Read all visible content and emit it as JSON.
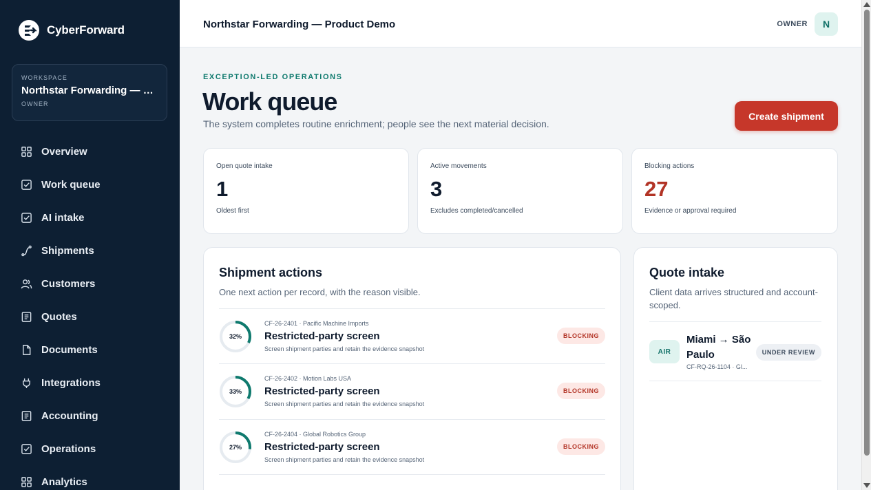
{
  "brand": {
    "name": "CyberForward"
  },
  "workspace": {
    "label": "WORKSPACE",
    "name": "Northstar Forwarding — Product Demo",
    "role": "OWNER"
  },
  "nav": [
    {
      "label": "Overview",
      "icon": "grid-icon"
    },
    {
      "label": "Work queue",
      "icon": "checkbox-icon"
    },
    {
      "label": "AI intake",
      "icon": "checkbox-icon"
    },
    {
      "label": "Shipments",
      "icon": "route-icon"
    },
    {
      "label": "Customers",
      "icon": "users-icon"
    },
    {
      "label": "Quotes",
      "icon": "list-doc-icon"
    },
    {
      "label": "Documents",
      "icon": "file-icon"
    },
    {
      "label": "Integrations",
      "icon": "plug-icon"
    },
    {
      "label": "Accounting",
      "icon": "list-doc-icon"
    },
    {
      "label": "Operations",
      "icon": "checkbox-icon"
    },
    {
      "label": "Analytics",
      "icon": "grid-icon"
    }
  ],
  "topbar": {
    "title": "Northstar Forwarding — Product Demo",
    "role": "OWNER",
    "avatar": "N"
  },
  "header": {
    "eyebrow": "EXCEPTION-LED OPERATIONS",
    "title": "Work queue",
    "subtitle": "The system completes routine enrichment; people see the next material decision.",
    "create_label": "Create shipment"
  },
  "stats": [
    {
      "label": "Open quote intake",
      "value": "1",
      "note": "Oldest first"
    },
    {
      "label": "Active movements",
      "value": "3",
      "note": "Excludes completed/cancelled"
    },
    {
      "label": "Blocking actions",
      "value": "27",
      "note": "Evidence or approval required"
    }
  ],
  "actions_panel": {
    "title": "Shipment actions",
    "subtitle": "One next action per record, with the reason visible.",
    "rows": [
      {
        "pct": 32,
        "pct_label": "32%",
        "meta": "CF-26-2401 · Pacific Machine Imports",
        "title": "Restricted-party screen",
        "desc": "Screen shipment parties and retain the evidence snapshot",
        "badge": "BLOCKING"
      },
      {
        "pct": 33,
        "pct_label": "33%",
        "meta": "CF-26-2402 · Motion Labs USA",
        "title": "Restricted-party screen",
        "desc": "Screen shipment parties and retain the evidence snapshot",
        "badge": "BLOCKING"
      },
      {
        "pct": 27,
        "pct_label": "27%",
        "meta": "CF-26-2404 · Global Robotics Group",
        "title": "Restricted-party screen",
        "desc": "Screen shipment parties and retain the evidence snapshot",
        "badge": "BLOCKING"
      }
    ]
  },
  "quote_panel": {
    "title": "Quote intake",
    "subtitle": "Client data arrives structured and account-scoped.",
    "item": {
      "mode": "AIR",
      "route": "Miami → São Paulo",
      "ref": "CF-RQ-26-1104 · Gl...",
      "status": "UNDER REVIEW"
    }
  },
  "colors": {
    "sidebar": "#0d1f33",
    "accent": "#0f7a6e",
    "danger": "#c6372a"
  }
}
